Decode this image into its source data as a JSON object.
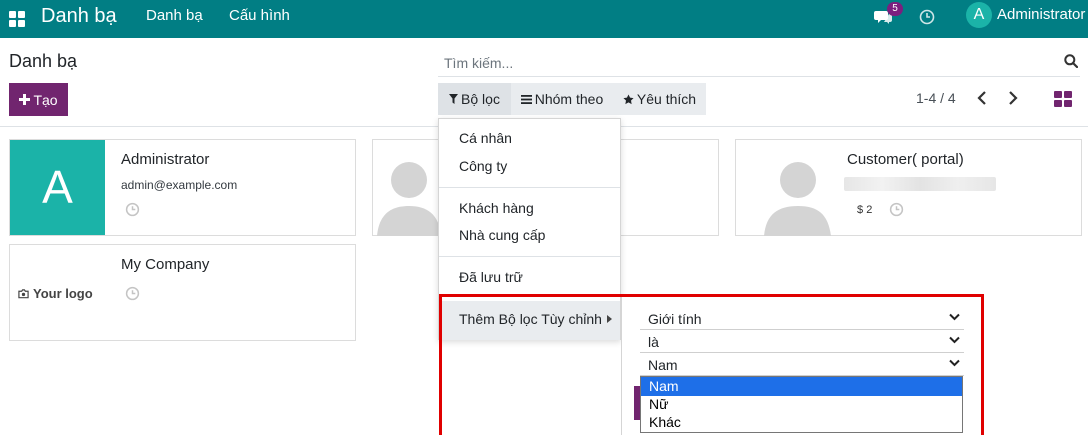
{
  "navbar": {
    "brand": "Danh bạ",
    "menu": [
      "Danh bạ",
      "Cấu hình"
    ],
    "chat_badge": "5",
    "user_initial": "A",
    "user_name": "Administrator",
    "bg_color": "#017e84"
  },
  "control_panel": {
    "title": "Danh bạ",
    "create_label": "Tạo",
    "search_placeholder": "Tìm kiếm...",
    "filters_label": "Bộ lọc",
    "groupby_label": "Nhóm theo",
    "favorites_label": "Yêu thích",
    "pager": "1-4 / 4",
    "accent_color": "#71256f"
  },
  "cards": [
    {
      "initial": "A",
      "name": "Administrator",
      "email": "admin@example.com"
    },
    {
      "name": "Customer( portal)",
      "count": "2"
    },
    {
      "logo_text": "Your logo",
      "name": "My Company"
    }
  ],
  "filter_dropdown": {
    "group1": [
      "Cá nhân",
      "Công ty"
    ],
    "group2": [
      "Khách hàng",
      "Nhà cung cấp"
    ],
    "group3": [
      "Đã lưu trữ"
    ],
    "custom_label": "Thêm Bộ lọc Tùy chỉnh"
  },
  "custom_filter": {
    "field": "Giới tính",
    "operator": "là",
    "value": "Nam",
    "options": [
      "Nam",
      "Nữ",
      "Khác"
    ],
    "selected_option": "Nam",
    "highlight_color": "#e00000"
  }
}
